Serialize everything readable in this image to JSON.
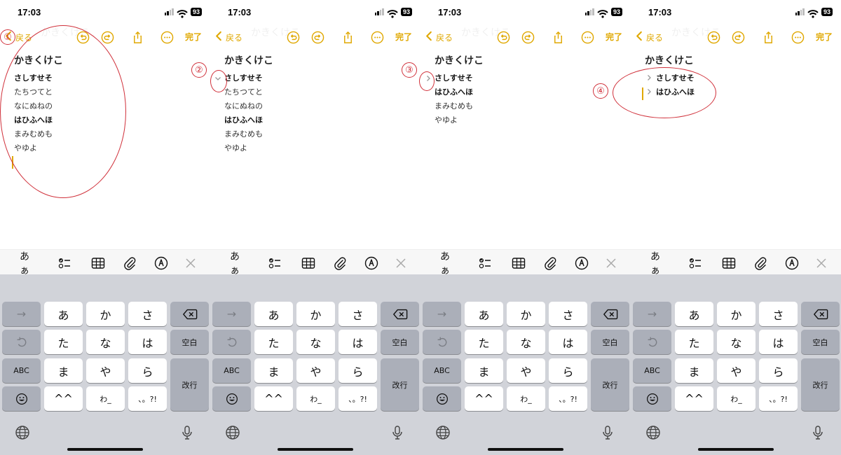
{
  "accent_color": "#e0a800",
  "annotation_color": "#d0303a",
  "status": {
    "time": "17:03",
    "battery": "93"
  },
  "nav": {
    "back_label": "戻る",
    "done_label": "完了",
    "ghost_text": "かきくけこ"
  },
  "note": {
    "title": "かきくけこ",
    "lines": [
      {
        "text": "さしすせそ",
        "bold": true
      },
      {
        "text": "たちつてと",
        "bold": false
      },
      {
        "text": "なにぬねの",
        "bold": false
      },
      {
        "text": "はひふへほ",
        "bold": true
      },
      {
        "text": "まみむめも",
        "bold": false
      },
      {
        "text": "やゆよ",
        "bold": false
      }
    ]
  },
  "steps": [
    "①",
    "②",
    "③",
    "④"
  ],
  "format_bar": {
    "aa_label": "あぁ",
    "icons": [
      "checklist-icon",
      "table-icon",
      "paperclip-icon",
      "markup-pen-icon",
      "close-icon"
    ]
  },
  "keyboard": {
    "row0": [
      "→",
      "あ",
      "か",
      "さ"
    ],
    "row1": [
      "た",
      "な",
      "は"
    ],
    "space_label": "空白",
    "abc_label": "ABC",
    "row2": [
      "ま",
      "や",
      "ら"
    ],
    "return_label": "改行",
    "row3": [
      "^^",
      "わ_",
      "、。?!"
    ]
  }
}
